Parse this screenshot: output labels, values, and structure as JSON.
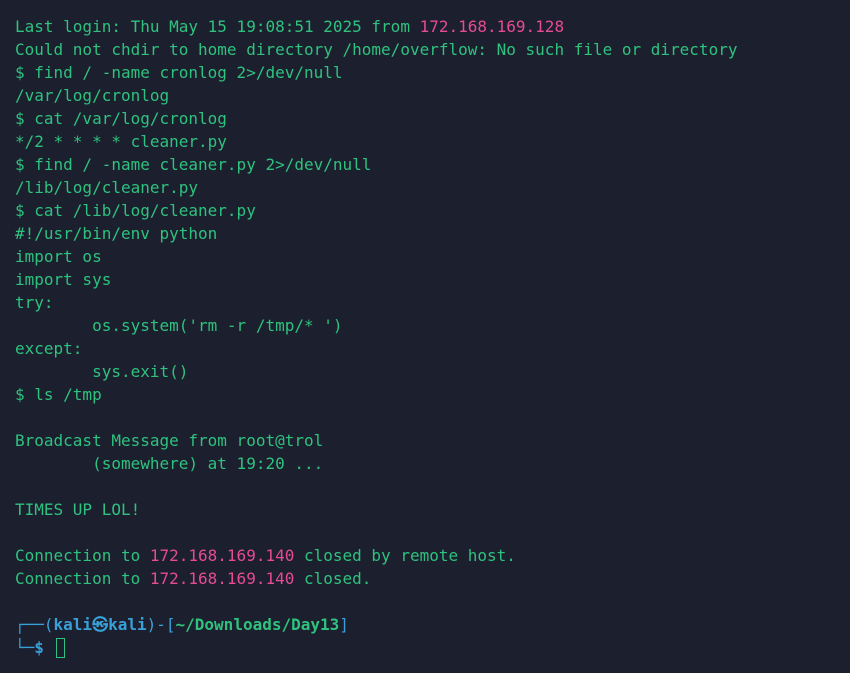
{
  "terminal": {
    "login": {
      "prefix": "Last login: Thu May 15 19:08:51 2025 from ",
      "ip": "172.168.169.128"
    },
    "lines": [
      "Could not chdir to home directory /home/overflow: No such file or directory",
      "$ find / -name cronlog 2>/dev/null",
      "/var/log/cronlog",
      "$ cat /var/log/cronlog",
      "*/2 * * * * cleaner.py",
      "$ find / -name cleaner.py 2>/dev/null",
      "/lib/log/cleaner.py",
      "$ cat /lib/log/cleaner.py",
      "#!/usr/bin/env python",
      "import os",
      "import sys",
      "try:",
      "        os.system('rm -r /tmp/* ')",
      "except:",
      "        sys.exit()",
      "$ ls /tmp",
      "",
      "Broadcast Message from root@trol",
      "        (somewhere) at 19:20 ...",
      "",
      "TIMES UP LOL!",
      ""
    ],
    "conn1": {
      "prefix": "Connection to ",
      "ip": "172.168.169.140",
      "suffix": " closed by remote host."
    },
    "conn2": {
      "prefix": "Connection to ",
      "ip": "172.168.169.140",
      "suffix": " closed."
    },
    "prompt": {
      "box_top_left": "┌──(",
      "user": "kali㉿kali",
      "box_mid": ")-[",
      "cwd": "~/Downloads/Day13",
      "box_end": "]",
      "box_bottom_left": "└─",
      "symbol": "$"
    }
  },
  "colors": {
    "background": "#1c1f2e",
    "text": "#2ec27e",
    "ip": "#e64b93",
    "prompt_accent": "#3aa0d8"
  }
}
